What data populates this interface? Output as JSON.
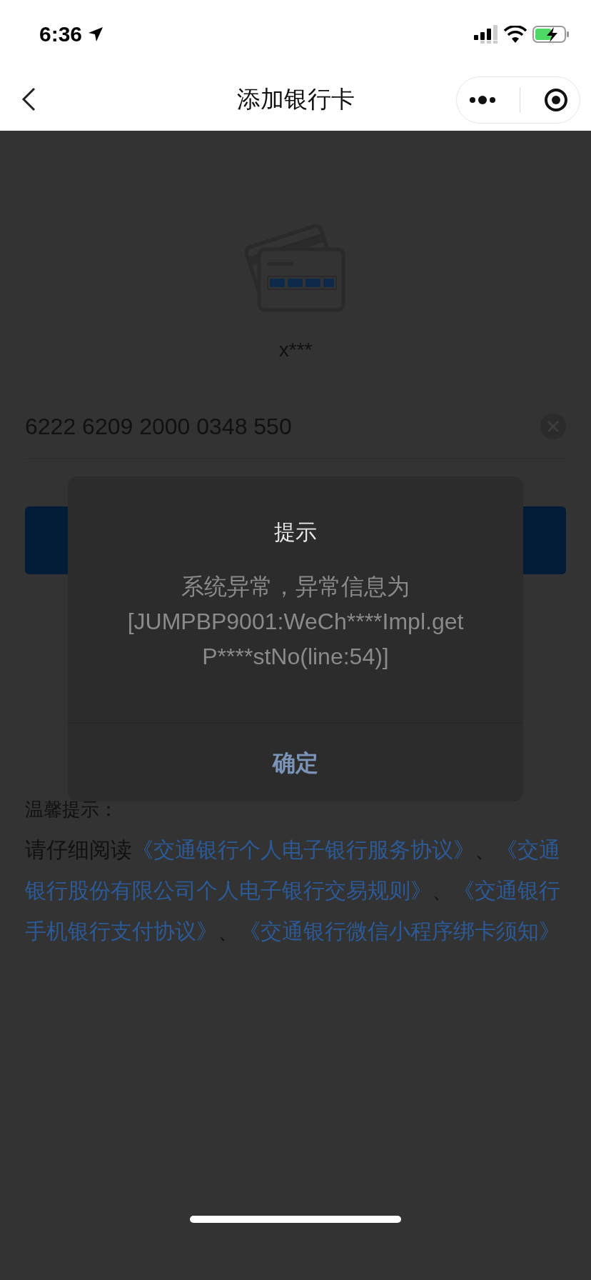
{
  "status_bar": {
    "time": "6:36"
  },
  "nav": {
    "title": "添加银行卡"
  },
  "card_holder": "x***",
  "card_number": {
    "value": "6222 6209 2000 0348 550"
  },
  "dialog": {
    "title": "提示",
    "message_lines": [
      "系统异常，异常信息为",
      "[JUMPBP9001:WeCh****Impl.get",
      "P****stNo(line:54)]"
    ],
    "button": "确定"
  },
  "notice": {
    "heading": "温馨提示：",
    "segments": [
      {
        "kind": "text",
        "text": "请仔细阅读"
      },
      {
        "kind": "link",
        "text": "《交通银行个人电子银行服务协议》"
      },
      {
        "kind": "text",
        "text": "、"
      },
      {
        "kind": "link",
        "text": "《交通银行股份有限公司个人电子银行交易规则》"
      },
      {
        "kind": "text",
        "text": "、"
      },
      {
        "kind": "link",
        "text": "《交通银行手机银行支付协议》"
      },
      {
        "kind": "text",
        "text": "、"
      },
      {
        "kind": "link",
        "text": "《交通银行微信小程序绑卡须知》"
      }
    ]
  }
}
